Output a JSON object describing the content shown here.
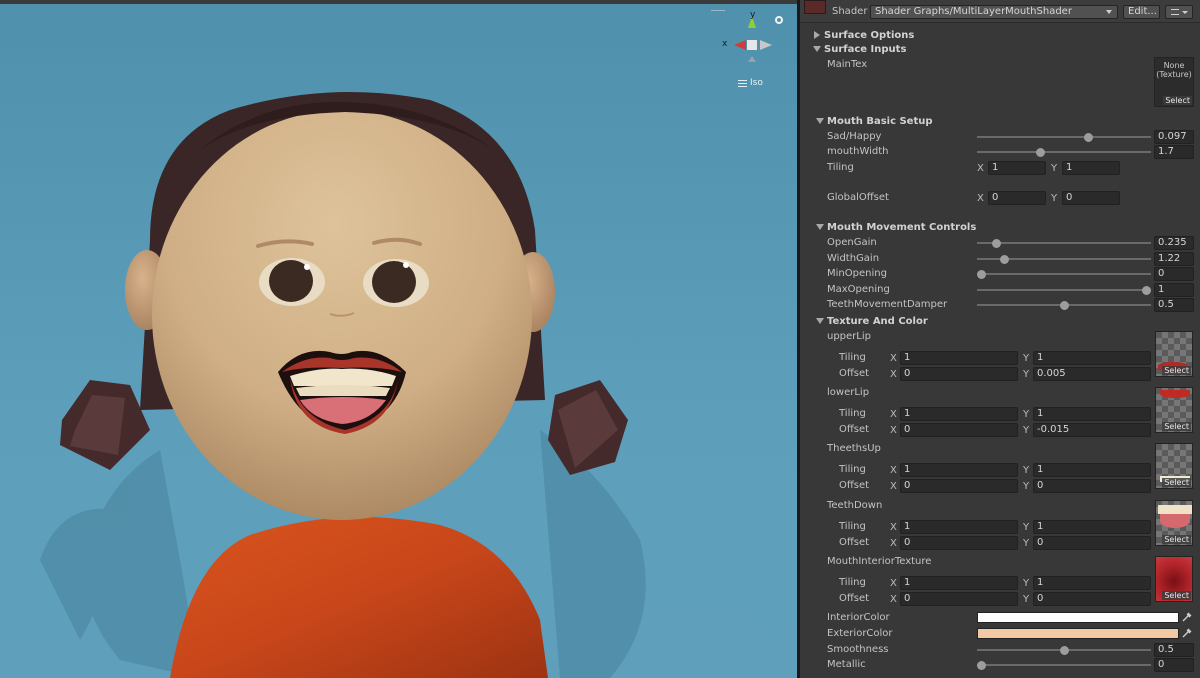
{
  "viewport": {
    "projection_label": "Iso",
    "gizmo_axis_x": "x",
    "gizmo_axis_y": "y"
  },
  "inspector": {
    "shader_label": "Shader",
    "shader_value": "Shader Graphs/MultiLayerMouthShader",
    "edit_button": "Edit...",
    "surface_options": "Surface Options",
    "surface_inputs": "Surface Inputs",
    "maintex_label": "MainTex",
    "maintex_value": "None\n(Texture)",
    "select_label": "Select",
    "mouth_basic_setup": "Mouth Basic Setup",
    "mouth_movement_controls": "Mouth Movement Controls",
    "texture_and_color": "Texture And Color",
    "tiling_label": "Tiling",
    "offset_label": "Offset",
    "global_offset_label": "GlobalOffset",
    "x_label": "X",
    "y_label": "Y",
    "sliders_basic": [
      {
        "label": "Sad/Happy",
        "value": "0.097",
        "fraction": 0.65
      },
      {
        "label": "mouthWidth",
        "value": "1.7",
        "fraction": 0.36
      }
    ],
    "basic_tiling": {
      "x": "1",
      "y": "1"
    },
    "basic_offset": {
      "x": "0",
      "y": "0"
    },
    "sliders_movement": [
      {
        "label": "OpenGain",
        "value": "0.235",
        "fraction": 0.09
      },
      {
        "label": "WidthGain",
        "value": "1.22",
        "fraction": 0.14
      },
      {
        "label": "MinOpening",
        "value": "0",
        "fraction": 0.0
      },
      {
        "label": "MaxOpening",
        "value": "1",
        "fraction": 1.0
      },
      {
        "label": "TeethMovementDamper",
        "value": "0.5",
        "fraction": 0.5
      }
    ],
    "textures": [
      {
        "label": "upperLip",
        "tiling_x": "1",
        "tiling_y": "1",
        "offset_x": "0",
        "offset_y": "0.005",
        "thumb": "upper-lip"
      },
      {
        "label": "lowerLip",
        "tiling_x": "1",
        "tiling_y": "1",
        "offset_x": "0",
        "offset_y": "-0.015",
        "thumb": "lower-lip"
      },
      {
        "label": "TheethsUp",
        "tiling_x": "1",
        "tiling_y": "1",
        "offset_x": "0",
        "offset_y": "0",
        "thumb": "teeth-up"
      },
      {
        "label": "TeethDown",
        "tiling_x": "1",
        "tiling_y": "1",
        "offset_x": "0",
        "offset_y": "0",
        "thumb": "teeth-down"
      },
      {
        "label": "MouthInteriorTexture",
        "tiling_x": "1",
        "tiling_y": "1",
        "offset_x": "0",
        "offset_y": "0",
        "thumb": "mouth-interior"
      }
    ],
    "interior_color_label": "InteriorColor",
    "interior_color": "#ffffff",
    "exterior_color_label": "ExteriorColor",
    "exterior_color": "#f1c9a5",
    "smoothness": {
      "label": "Smoothness",
      "value": "0.5",
      "fraction": 0.5
    },
    "metallic": {
      "label": "Metallic",
      "value": "0",
      "fraction": 0.0
    }
  }
}
